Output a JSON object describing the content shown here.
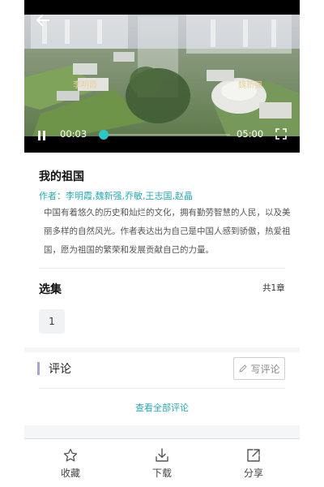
{
  "video": {
    "current_time": "00:03",
    "duration": "05:00",
    "progress": 0.01,
    "overlay_left": "李明霞",
    "overlay_right": "魏新强"
  },
  "content": {
    "title": "我的祖国",
    "author_label": "作者：",
    "authors": "李明霞,魏新强,乔敏,王志国,赵晶",
    "description": "中国有着悠久的历史和灿烂的文化，拥有勤劳智慧的人民，以及美丽多样的自然风光。作者表达出为自己是中国人感到骄傲，热爱祖国，愿为祖国的繁荣和发展贡献自己的力量。"
  },
  "episodes": {
    "title": "选集",
    "count": "共1章",
    "items": [
      "1"
    ]
  },
  "comments": {
    "title": "评论",
    "write_label": "写评论",
    "view_all": "查看全部评论"
  },
  "bottom_nav": {
    "favorite": "收藏",
    "download": "下载",
    "share": "分享"
  },
  "colors": {
    "accent": "#2ec7c9",
    "link": "#2aa8b4",
    "section_bar": "#a7a3d8"
  }
}
